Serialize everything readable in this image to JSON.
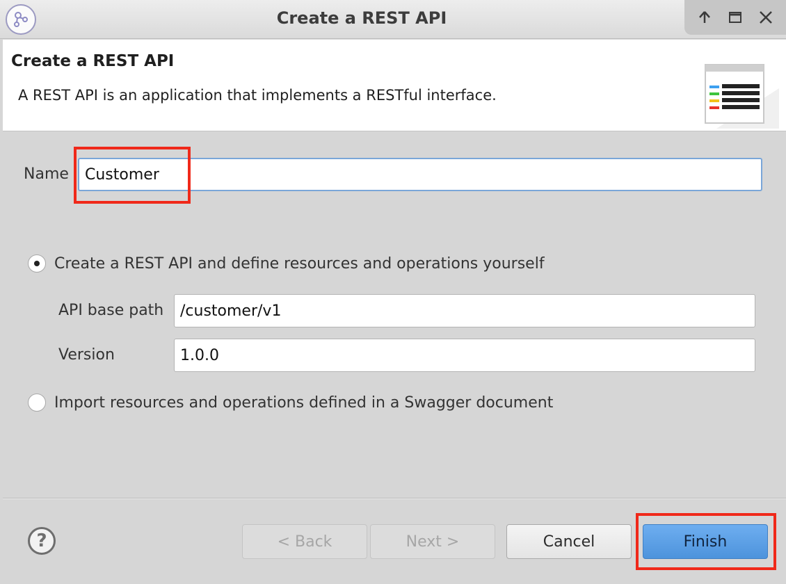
{
  "window": {
    "title": "Create a REST API"
  },
  "banner": {
    "title": "Create a REST API",
    "description": "A REST API is an application that implements a RESTful interface."
  },
  "form": {
    "name_label": "Name",
    "name_value": "Customer",
    "option_define": {
      "label": "Create a REST API and define resources and operations yourself",
      "selected": true
    },
    "base_path_label": "API base path",
    "base_path_value": "/customer/v1",
    "version_label": "Version",
    "version_value": "1.0.0",
    "option_import": {
      "label": "Import resources and operations defined in a Swagger document",
      "selected": false
    }
  },
  "footer": {
    "help_label": "?",
    "back_label": "< Back",
    "next_label": "Next >",
    "cancel_label": "Cancel",
    "finish_label": "Finish"
  },
  "icons": {
    "app": "workflow-icon",
    "minimize": "arrow-up-icon",
    "maximize": "maximize-icon",
    "close": "close-icon",
    "banner": "api-document-icon",
    "help": "help-icon"
  },
  "colors": {
    "highlight": "#f0291a",
    "primary_button": "#5a9fe6",
    "focus_border": "#7aa6d8"
  }
}
